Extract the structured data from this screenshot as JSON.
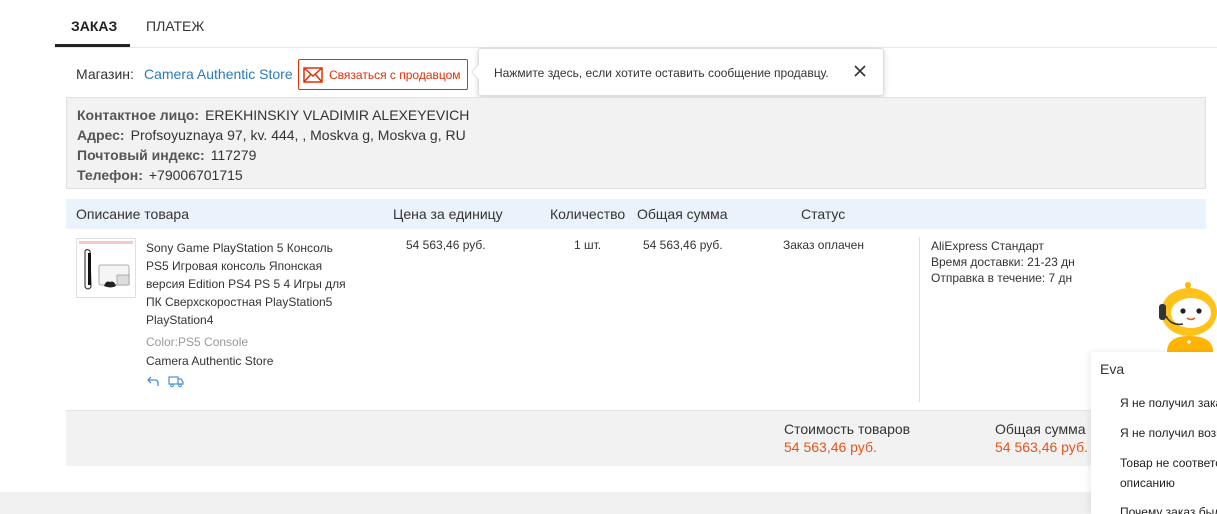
{
  "tabs": [
    {
      "label": "ЗАКАЗ",
      "active": true
    },
    {
      "label": "ПЛАТЕЖ",
      "active": false
    }
  ],
  "store": {
    "label": "Магазин:",
    "name": "Camera Authentic Store",
    "contact_button": "Связаться с продавцом"
  },
  "tooltip": {
    "text": "Нажмите здесь, если хотите оставить сообщение продавцу."
  },
  "address": {
    "contact_label": "Контактное лицо:",
    "contact_value": "EREKHINSKIY VLADIMIR ALEXEYEVICH",
    "address_label": "Адрес:",
    "address_value": "Profsoyuznaya 97, kv. 444, , Moskva g, Moskva g, RU",
    "zip_label": "Почтовый индекс:",
    "zip_value": "117279",
    "phone_label": "Телефон:",
    "phone_value": "+79006701715"
  },
  "table": {
    "headers": {
      "description": "Описание товара",
      "unit_price": "Цена за единицу",
      "quantity": "Количество",
      "total": "Общая сумма",
      "status": "Статус"
    },
    "item": {
      "title": "Sony Game PlayStation 5 Консоль PS5 Игровая консоль Японская версия Edition PS4 PS 5 4 Игры для ПК Сверхскоростная PlayStation5 PlayStation4",
      "color": "Color:PS5 Console",
      "store": "Camera Authentic Store",
      "unit_price": "54 563,46 руб.",
      "quantity": "1 шт.",
      "total": "54 563,46 руб.",
      "status": "Заказ оплачен",
      "shipping_method": "AliExpress Стандарт",
      "delivery_time": "Время доставки: 21-23 дн",
      "dispatch_time": "Отправка в течение: 7 дн"
    }
  },
  "summary": {
    "goods_cost_label": "Стоимость товаров",
    "goods_cost_value": "54 563,46 руб.",
    "total_label": "Общая сумма",
    "total_value": "54 563,46 руб."
  },
  "assistant": {
    "name": "Eva",
    "questions": [
      "Я не получил заказ",
      "Я не получил возврат",
      "Товар не соответствует",
      "описанию",
      "Почему заказ был"
    ]
  },
  "colors": {
    "accent": "#e62e04",
    "link": "#2b7bb9",
    "price": "#e6541b",
    "header_bg": "#eaf3fb"
  }
}
